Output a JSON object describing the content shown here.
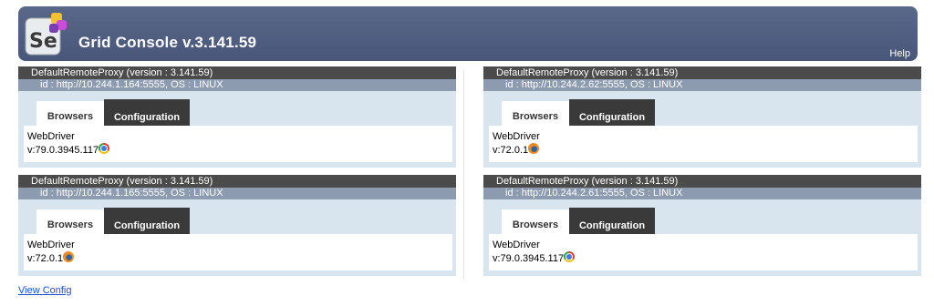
{
  "header": {
    "logo_text": "Se",
    "title": "Grid Console v.3.141.59",
    "help_label": "Help"
  },
  "proxies": [
    {
      "title": "DefaultRemoteProxy (version : 3.141.59)",
      "id_line": "id : http://10.244.1.164:5555, OS : LINUX",
      "tab_browsers": "Browsers",
      "tab_config": "Configuration",
      "driver": "WebDriver",
      "version": "v:79.0.3945.117",
      "browser_icon": "chrome-icon"
    },
    {
      "title": "DefaultRemoteProxy (version : 3.141.59)",
      "id_line": "id : http://10.244.1.165:5555, OS : LINUX",
      "tab_browsers": "Browsers",
      "tab_config": "Configuration",
      "driver": "WebDriver",
      "version": "v:72.0.1",
      "browser_icon": "firefox-icon"
    },
    {
      "title": "DefaultRemoteProxy (version : 3.141.59)",
      "id_line": "id : http://10.244.2.62:5555, OS : LINUX",
      "tab_browsers": "Browsers",
      "tab_config": "Configuration",
      "driver": "WebDriver",
      "version": "v:72.0.1",
      "browser_icon": "firefox-icon"
    },
    {
      "title": "DefaultRemoteProxy (version : 3.141.59)",
      "id_line": "id : http://10.244.2.61:5555, OS : LINUX",
      "tab_browsers": "Browsers",
      "tab_config": "Configuration",
      "driver": "WebDriver",
      "version": "v:79.0.3945.117",
      "browser_icon": "chrome-icon"
    }
  ],
  "footer": {
    "view_config_label": "View Config"
  },
  "colors": {
    "header_bg": "#4d5b7a",
    "proxy_head_bg": "#4b4b4b",
    "proxy_id_bg": "#8c9bb0",
    "proxy_body_bg": "#d8e5ef",
    "link": "#1a4fd6"
  }
}
